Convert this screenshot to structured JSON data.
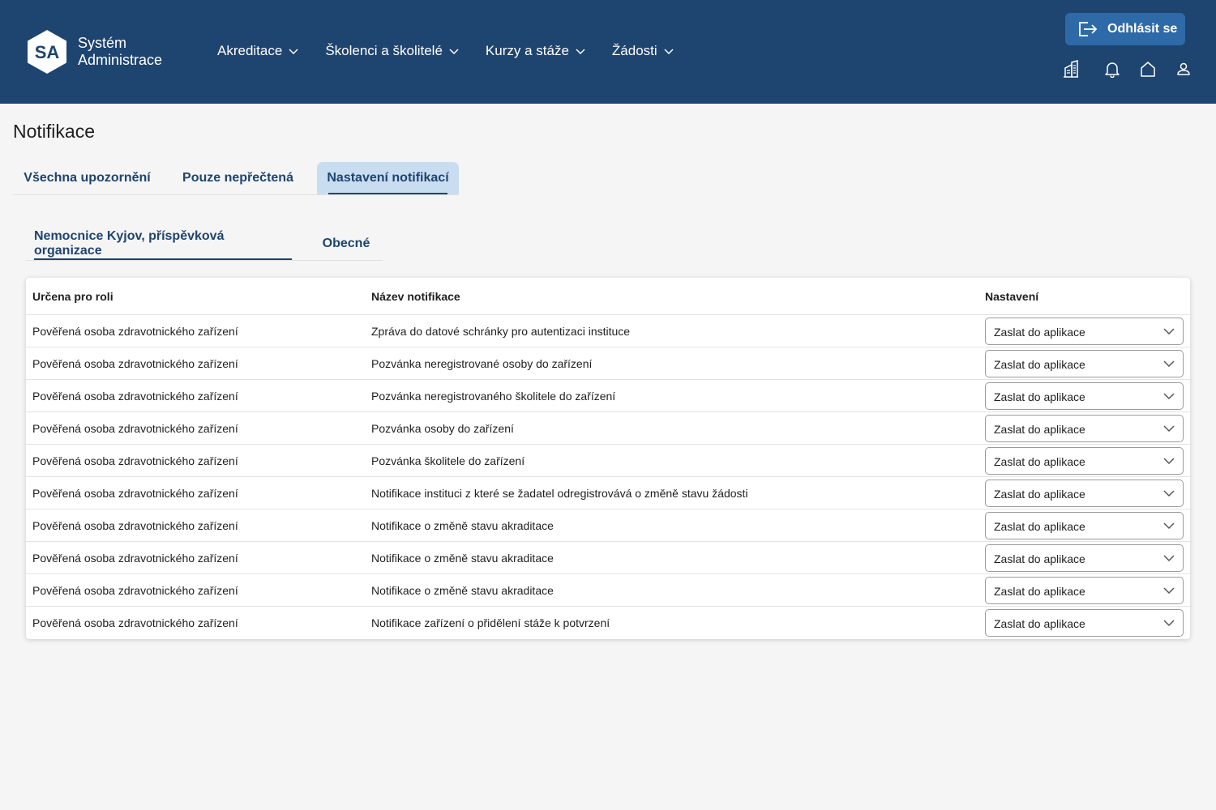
{
  "header": {
    "logo_initials": "SA",
    "app_name_line1": "Systém",
    "app_name_line2": "Administrace",
    "nav": [
      {
        "label": "Akreditace",
        "icon": "chevron-down-icon"
      },
      {
        "label": "Školenci a školitelé",
        "icon": "chevron-down-icon"
      },
      {
        "label": "Kurzy a stáže",
        "icon": "chevron-down-icon"
      },
      {
        "label": "Žádosti",
        "icon": "chevron-down-icon"
      }
    ],
    "logout_label": "Odhlásit se",
    "icons": [
      "building-icon",
      "bell-icon",
      "home-icon",
      "user-icon"
    ]
  },
  "page": {
    "title": "Notifikace",
    "tabs": [
      {
        "label": "Všechna upozornění",
        "active": false
      },
      {
        "label": "Pouze nepřečtená",
        "active": false
      },
      {
        "label": "Nastavení notifikací",
        "active": true
      }
    ],
    "subtabs": [
      {
        "label": "Nemocnice Kyjov, příspěvková organizace",
        "active": true
      },
      {
        "label": "Obecné",
        "active": false
      }
    ]
  },
  "table": {
    "headers": [
      "Určena pro roli",
      "Název notifikace",
      "Nastavení"
    ],
    "rows": [
      {
        "role": "Pověřená osoba zdravotnického zařízení",
        "name": "Zpráva do datové schránky pro autentizaci instituce",
        "setting": "Zaslat do aplikace"
      },
      {
        "role": "Pověřená osoba zdravotnického zařízení",
        "name": "Pozvánka neregistrované osoby do zařízení",
        "setting": "Zaslat do aplikace"
      },
      {
        "role": "Pověřená osoba zdravotnického zařízení",
        "name": "Pozvánka neregistrovaného školitele do zařízení",
        "setting": "Zaslat do aplikace"
      },
      {
        "role": "Pověřená osoba zdravotnického zařízení",
        "name": "Pozvánka osoby do zařízení",
        "setting": "Zaslat do aplikace"
      },
      {
        "role": "Pověřená osoba zdravotnického zařízení",
        "name": "Pozvánka školitele do zařízení",
        "setting": "Zaslat do aplikace"
      },
      {
        "role": "Pověřená osoba zdravotnického zařízení",
        "name": "Notifikace instituci z které se žadatel odregistrovává o změně stavu žádosti",
        "setting": "Zaslat do aplikace"
      },
      {
        "role": "Pověřená osoba zdravotnického zařízení",
        "name": "Notifikace o změně stavu akraditace",
        "setting": "Zaslat do aplikace"
      },
      {
        "role": "Pověřená osoba zdravotnického zařízení",
        "name": "Notifikace o změně stavu akraditace",
        "setting": "Zaslat do aplikace"
      },
      {
        "role": "Pověřená osoba zdravotnického zařízení",
        "name": "Notifikace o změně stavu akraditace",
        "setting": "Zaslat do aplikace"
      },
      {
        "role": "Pověřená osoba zdravotnického zařízení",
        "name": "Notifikace zařízení o přidělení stáže k potvrzení",
        "setting": "Zaslat do aplikace"
      }
    ]
  },
  "colors": {
    "header_bg": "#1e4470",
    "button_bg": "#2f6aa8",
    "active_tab_bg": "#c9ddf1",
    "accent": "#1e4470"
  }
}
